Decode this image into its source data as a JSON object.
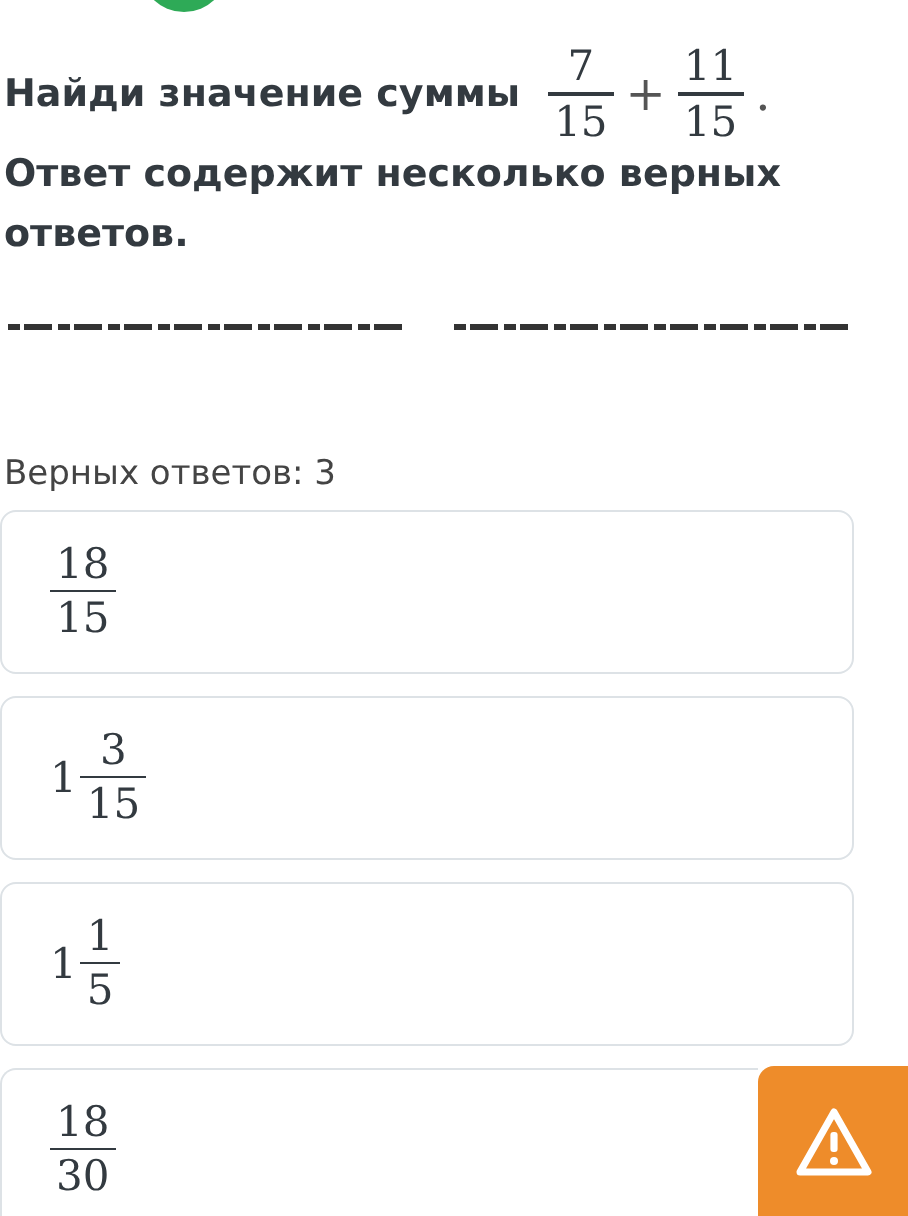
{
  "question": {
    "text": "Найди значение суммы",
    "expression": [
      {
        "kind": "fraction",
        "numerator": "7",
        "denominator": "15"
      },
      {
        "kind": "operator",
        "text": "+"
      },
      {
        "kind": "fraction",
        "numerator": "11",
        "denominator": "15"
      },
      {
        "kind": "operator",
        "text": "."
      }
    ]
  },
  "instruction": "Ответ содержит несколько верных ответов.",
  "answer_count": "Верных ответов: 3",
  "options": [
    {
      "numerator": "18",
      "denominator": "15"
    },
    {
      "whole": "1",
      "numerator": "3",
      "denominator": "15"
    },
    {
      "whole": "1",
      "numerator": "1",
      "denominator": "5"
    },
    {
      "numerator": "18",
      "denominator": "30"
    }
  ]
}
